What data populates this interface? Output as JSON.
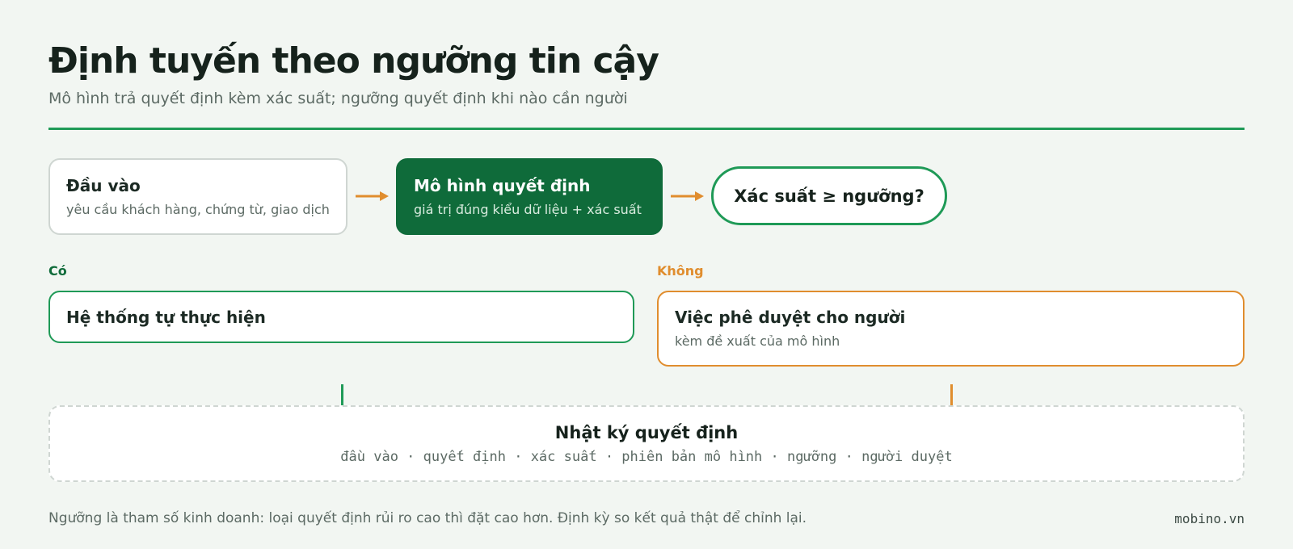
{
  "header": {
    "title": "Định tuyến theo ngưỡng tin cậy",
    "subtitle": "Mô hình trả quyết định kèm xác suất; ngưỡng quyết định khi nào cần người"
  },
  "flow": {
    "input": {
      "title": "Đầu vào",
      "detail": "yêu cầu khách hàng, chứng từ, giao dịch"
    },
    "model": {
      "title": "Mô hình quyết định",
      "detail": "giá trị đúng kiểu dữ liệu + xác suất"
    },
    "decision": {
      "label": "Xác suất ≥ ngưỡng?"
    }
  },
  "branches": {
    "yes": {
      "label": "Có",
      "title": "Hệ thống tự thực hiện"
    },
    "no": {
      "label": "Không",
      "title": "Việc phê duyệt cho người",
      "detail": "kèm đề xuất của mô hình"
    }
  },
  "log": {
    "title": "Nhật ký quyết định",
    "fields": "đầu vào · quyết định · xác suất · phiên bản mô hình · ngưỡng · người duyệt"
  },
  "footer": {
    "note": "Ngưỡng là tham số kinh doanh: loại quyết định rủi ro cao thì đặt cao hơn. Định kỳ so kết quả thật để chỉnh lại.",
    "brand": "mobino.vn"
  },
  "colors": {
    "accent_green": "#1f9a57",
    "dark_green": "#0f6b3a",
    "orange": "#e08d2e",
    "background": "#f2f6f2"
  }
}
